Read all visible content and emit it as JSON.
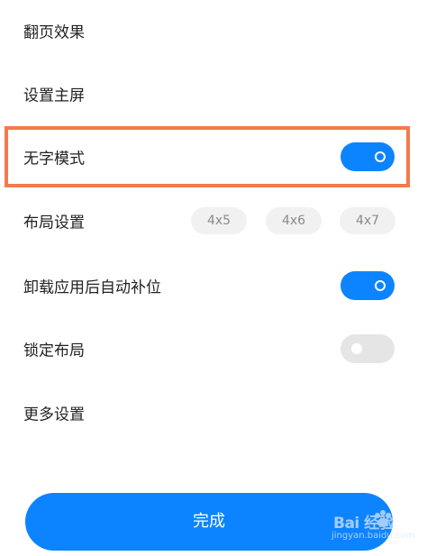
{
  "settings": {
    "page_turn_effect": {
      "label": "翻页效果"
    },
    "set_home_screen": {
      "label": "设置主屏"
    },
    "no_text_mode": {
      "label": "无字模式",
      "enabled": true
    },
    "layout_settings": {
      "label": "布局设置",
      "options": [
        "4x5",
        "4x6",
        "4x7"
      ]
    },
    "auto_fill_after_uninstall": {
      "label": "卸载应用后自动补位",
      "enabled": true
    },
    "lock_layout": {
      "label": "锁定布局",
      "enabled": false
    },
    "more_settings": {
      "label": "更多设置"
    }
  },
  "footer": {
    "done_label": "完成"
  },
  "watermark": {
    "brand": "Bai  经验",
    "url": "jingyan.baidu.com"
  },
  "colors": {
    "accent": "#0d84ff",
    "highlight": "#f27a4b",
    "toggle_off": "#e5e5e5",
    "option_bg": "#f1f1f1"
  }
}
